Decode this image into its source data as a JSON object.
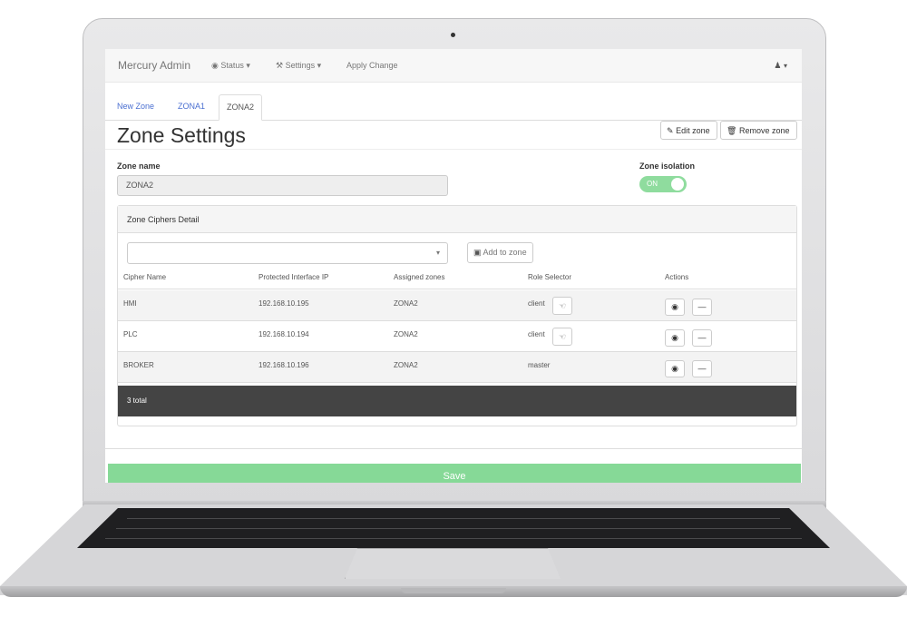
{
  "navbar": {
    "brand": "Mercury Admin",
    "status_label": "Status",
    "status_icon": "dashboard-icon",
    "settings_label": "Settings",
    "settings_icon": "wrench-icon",
    "apply_label": "Apply Change",
    "user_icon": "user-icon"
  },
  "tabs": [
    {
      "label": "New Zone"
    },
    {
      "label": "ZONA1"
    },
    {
      "label": "ZONA2"
    }
  ],
  "page": {
    "title": "Zone Settings",
    "edit_label": "Edit zone",
    "remove_label": "Remove zone"
  },
  "form": {
    "zone_name_label": "Zone name",
    "zone_name_value": "ZONA2",
    "isolation_label": "Zone isolation",
    "isolation_state": "ON"
  },
  "ciphers": {
    "panel_title": "Zone Ciphers Detail",
    "select_value": "",
    "add_label": "Add to zone",
    "columns": [
      "Cipher Name",
      "Protected Interface IP",
      "Assigned zones",
      "Role Selector",
      "Actions"
    ],
    "rows": [
      {
        "name": "HMI",
        "ip": "192.168.10.195",
        "zones": "ZONA2",
        "role": "client"
      },
      {
        "name": "PLC",
        "ip": "192.168.10.194",
        "zones": "ZONA2",
        "role": "client"
      },
      {
        "name": "BROKER",
        "ip": "192.168.10.196",
        "zones": "ZONA2",
        "role": "master"
      }
    ],
    "total_label": "3 total"
  },
  "save_label": "Save",
  "colors": {
    "accent_link": "#4a6fd1",
    "save_green": "#86d997",
    "toggle_green": "#8fdc9e",
    "footer_dark": "#444444"
  }
}
